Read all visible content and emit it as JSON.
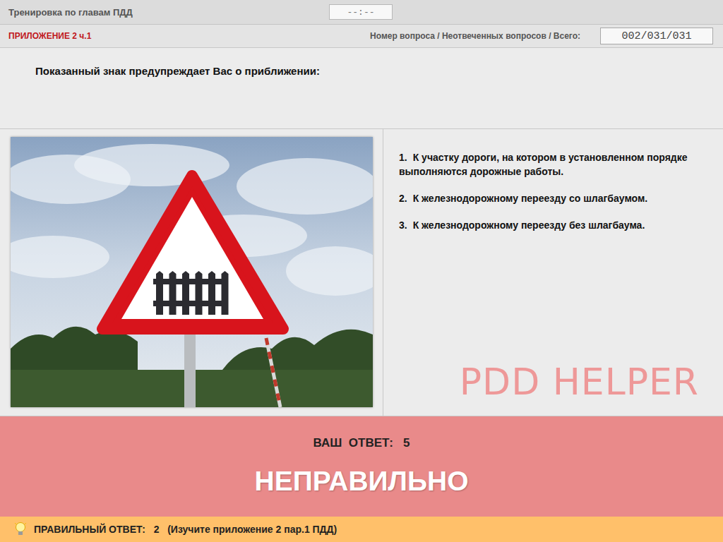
{
  "header": {
    "title": "Тренировка по главам ПДД",
    "timer": "--:--"
  },
  "subheader": {
    "section": "ПРИЛОЖЕНИЕ 2 ч.1",
    "counter_label": "Номер вопроса / Неотвеченных вопросов / Всего:",
    "counter": "002/031/031"
  },
  "question": "Показанный знак предупреждает Вас о приближении:",
  "answers": [
    {
      "number": "1.",
      "text": "К участку дороги, на котором в установленном порядке выполняются дорожные работы."
    },
    {
      "number": "2.",
      "text": "К железнодорожному переезду со шлагбаумом."
    },
    {
      "number": "3.",
      "text": "К железнодорожному переезду без шлагбаума."
    }
  ],
  "watermark": "PDD HELPER",
  "result": {
    "answer_label": "ВАШ  ОТВЕТ:",
    "answer": "5",
    "verdict": "НЕПРАВИЛЬНО",
    "correct": false
  },
  "hint": {
    "label": "ПРАВИЛЬНЫЙ ОТВЕТ:",
    "answer": "2",
    "reference": "(Изучите приложение 2 пар.1 ПДД)"
  }
}
